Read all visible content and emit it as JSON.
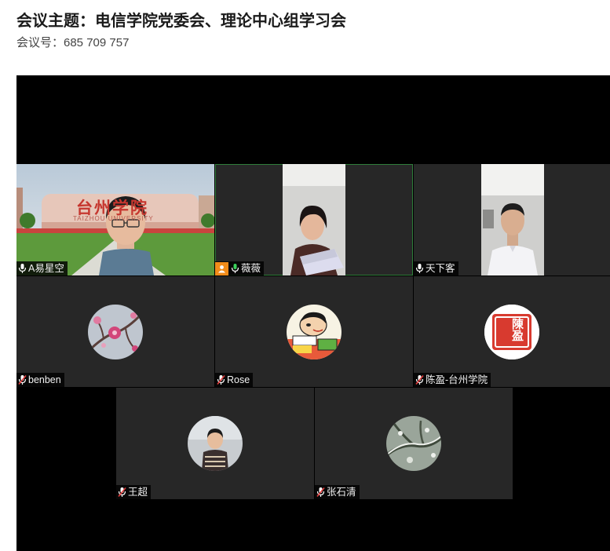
{
  "meeting": {
    "title": "会议主题：电信学院党委会、理论中心组学习会",
    "meeting_id": "会议号：685 709 757"
  },
  "participants": [
    {
      "name": "A易星空",
      "mic": "on",
      "video": "on"
    },
    {
      "name": "薇薇",
      "mic": "on",
      "video": "on",
      "host": true
    },
    {
      "name": "天下客",
      "mic": "on",
      "video": "on"
    },
    {
      "name": "benben",
      "mic": "muted",
      "video": "off"
    },
    {
      "name": "Rose",
      "mic": "muted",
      "video": "off"
    },
    {
      "name": "陈盈-台州学院",
      "mic": "muted",
      "video": "off"
    },
    {
      "name": "王超",
      "mic": "muted",
      "video": "off"
    },
    {
      "name": "张石清",
      "mic": "muted",
      "video": "off"
    }
  ],
  "backdrop": {
    "sign_text": "台州学院",
    "sign_sub": "TAIZHOU UNIVERSITY"
  },
  "avatar_seal_text": "陳盈",
  "colors": {
    "tile_bg": "#272727",
    "stage_bg": "#000000",
    "active_border": "#2f7d3a",
    "host_badge": "#f28c1a",
    "mic_on": "#ffffff",
    "mic_muted": "#e23b3b"
  }
}
